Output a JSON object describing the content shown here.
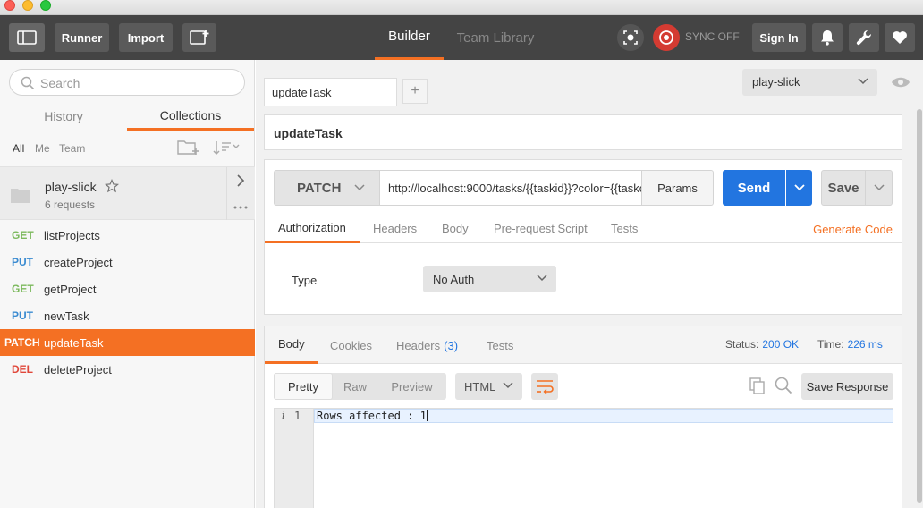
{
  "toolbar": {
    "runner_label": "Runner",
    "import_label": "Import",
    "builder_label": "Builder",
    "team_library_label": "Team Library",
    "sync_label": "SYNC OFF",
    "signin_label": "Sign In"
  },
  "sidebar": {
    "search_placeholder": "Search",
    "tabs": {
      "history": "History",
      "collections": "Collections"
    },
    "filters": {
      "all": "All",
      "me": "Me",
      "team": "Team"
    },
    "collection": {
      "name": "play-slick",
      "count": "6 requests"
    },
    "requests": [
      {
        "method": "GET",
        "name": "listProjects"
      },
      {
        "method": "PUT",
        "name": "createProject"
      },
      {
        "method": "GET",
        "name": "getProject"
      },
      {
        "method": "PUT",
        "name": "newTask"
      },
      {
        "method": "PATCH",
        "name": "updateTask",
        "active": true
      },
      {
        "method": "DEL",
        "name": "deleteProject"
      }
    ]
  },
  "main": {
    "request_tab_label": "updateTask",
    "add_tab_label": "+",
    "environment": "play-slick",
    "request_name": "updateTask",
    "method": "PATCH",
    "url": "http://localhost:9000/tasks/{{taskid}}?color={{taskc",
    "params_label": "Params",
    "send_label": "Send",
    "save_label": "Save",
    "request_tabs": [
      "Authorization",
      "Headers",
      "Body",
      "Pre-request Script",
      "Tests"
    ],
    "generate_code_label": "Generate Code",
    "auth_type_label": "Type",
    "auth_type_value": "No Auth"
  },
  "response": {
    "tabs": {
      "body": "Body",
      "cookies": "Cookies",
      "headers": "Headers",
      "headers_count": "(3)",
      "tests": "Tests"
    },
    "status_label": "Status:",
    "status_value": "200 OK",
    "time_label": "Time:",
    "time_value": "226 ms",
    "view_modes": {
      "pretty": "Pretty",
      "raw": "Raw",
      "preview": "Preview"
    },
    "format": "HTML",
    "save_response_label": "Save Response",
    "gutter_info": "i",
    "line_number": "1",
    "body_text": "Rows affected : 1"
  },
  "colors": {
    "accent": "#f47023",
    "send_blue": "#2275e0",
    "get": "#7cb95d",
    "put": "#3a8bd1",
    "del": "#e0473a",
    "sync_red": "#d43b32"
  }
}
